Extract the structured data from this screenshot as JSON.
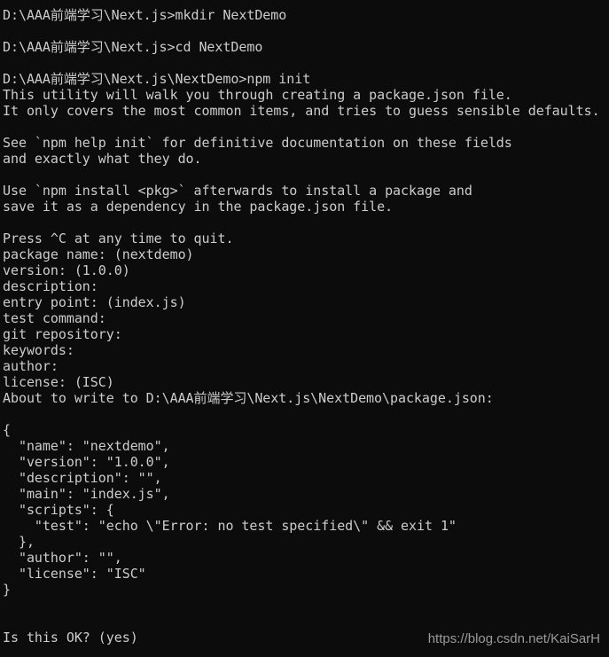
{
  "terminal": {
    "lines": [
      "D:\\AAA前端学习\\Next.js>mkdir NextDemo",
      "",
      "D:\\AAA前端学习\\Next.js>cd NextDemo",
      "",
      "D:\\AAA前端学习\\Next.js\\NextDemo>npm init",
      "This utility will walk you through creating a package.json file.",
      "It only covers the most common items, and tries to guess sensible defaults.",
      "",
      "See `npm help init` for definitive documentation on these fields",
      "and exactly what they do.",
      "",
      "Use `npm install <pkg>` afterwards to install a package and",
      "save it as a dependency in the package.json file.",
      "",
      "Press ^C at any time to quit.",
      "package name: (nextdemo)",
      "version: (1.0.0)",
      "description:",
      "entry point: (index.js)",
      "test command:",
      "git repository:",
      "keywords:",
      "author:",
      "license: (ISC)",
      "About to write to D:\\AAA前端学习\\Next.js\\NextDemo\\package.json:",
      "",
      "{",
      "  \"name\": \"nextdemo\",",
      "  \"version\": \"1.0.0\",",
      "  \"description\": \"\",",
      "  \"main\": \"index.js\",",
      "  \"scripts\": {",
      "    \"test\": \"echo \\\"Error: no test specified\\\" && exit 1\"",
      "  },",
      "  \"author\": \"\",",
      "  \"license\": \"ISC\"",
      "}",
      "",
      "",
      "Is this OK? (yes)"
    ]
  },
  "watermark": "https://blog.csdn.net/KaiSarH",
  "colors": {
    "background": "#0c0c0c",
    "text": "#cccccc"
  }
}
